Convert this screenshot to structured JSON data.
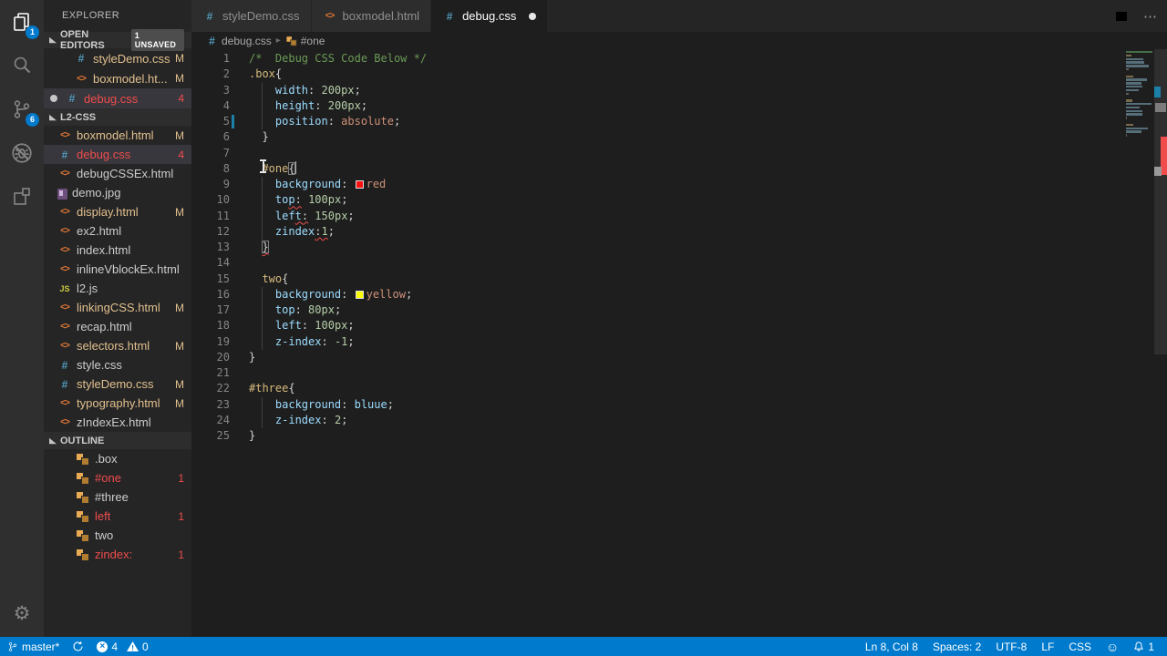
{
  "activity_bar": {
    "explorer_badge": "1",
    "scm_badge": "6"
  },
  "sidebar": {
    "title": "EXPLORER",
    "open_editors": {
      "label": "OPEN EDITORS",
      "badge": "1 UNSAVED",
      "items": [
        {
          "name": "styleDemo.css",
          "icon": "css",
          "git": "M",
          "modified": true
        },
        {
          "name": "boxmodel.ht...",
          "icon": "html",
          "git": "M",
          "modified": true
        },
        {
          "name": "debug.css",
          "icon": "css",
          "git": "4",
          "git_error": true,
          "error_name": true,
          "dirty": true,
          "selected": true
        }
      ]
    },
    "folder": {
      "label": "L2-CSS",
      "files": [
        {
          "name": "boxmodel.html",
          "icon": "html",
          "git": "M",
          "modified": true
        },
        {
          "name": "debug.css",
          "icon": "css",
          "git": "4",
          "git_error": true,
          "error_name": true,
          "selected": true
        },
        {
          "name": "debugCSSEx.html",
          "icon": "html"
        },
        {
          "name": "demo.jpg",
          "icon": "img"
        },
        {
          "name": "display.html",
          "icon": "html",
          "git": "M",
          "modified": true
        },
        {
          "name": "ex2.html",
          "icon": "html"
        },
        {
          "name": "index.html",
          "icon": "html"
        },
        {
          "name": "inlineVblockEx.html",
          "icon": "html"
        },
        {
          "name": "l2.js",
          "icon": "js"
        },
        {
          "name": "linkingCSS.html",
          "icon": "html",
          "git": "M",
          "modified": true
        },
        {
          "name": "recap.html",
          "icon": "html"
        },
        {
          "name": "selectors.html",
          "icon": "html",
          "git": "M",
          "modified": true
        },
        {
          "name": "style.css",
          "icon": "css"
        },
        {
          "name": "styleDemo.css",
          "icon": "css",
          "git": "M",
          "modified": true
        },
        {
          "name": "typography.html",
          "icon": "html",
          "git": "M",
          "modified": true
        },
        {
          "name": "zIndexEx.html",
          "icon": "html"
        }
      ]
    },
    "outline": {
      "label": "OUTLINE",
      "items": [
        {
          "name": ".box"
        },
        {
          "name": "#one",
          "badge": "1",
          "error_name": true
        },
        {
          "name": "#three"
        },
        {
          "name": "left",
          "badge": "1",
          "error_name": true
        },
        {
          "name": "two"
        },
        {
          "name": "zindex:",
          "badge": "1",
          "error_name": true
        }
      ]
    }
  },
  "tabs": [
    {
      "name": "styleDemo.css",
      "icon": "css",
      "active": false,
      "dirty": false
    },
    {
      "name": "boxmodel.html",
      "icon": "html",
      "active": false,
      "dirty": false
    },
    {
      "name": "debug.css",
      "icon": "css",
      "active": true,
      "dirty": true
    }
  ],
  "breadcrumb": [
    {
      "label": "debug.css",
      "icon": "css"
    },
    {
      "label": "#one",
      "icon": "symbol"
    }
  ],
  "code": {
    "lines": [
      {
        "n": 1,
        "s": [
          {
            "t": "/*  Debug CSS Code Below */",
            "c": "cm"
          }
        ]
      },
      {
        "n": 2,
        "s": [
          {
            "t": ".box",
            "c": "sel"
          },
          {
            "t": "{",
            "c": "pu"
          }
        ]
      },
      {
        "n": 3,
        "s": [
          {
            "t": "    "
          },
          {
            "t": "width",
            "c": "pr"
          },
          {
            "t": ": ",
            "c": "pu"
          },
          {
            "t": "200px",
            "c": "num"
          },
          {
            "t": ";",
            "c": "pu"
          }
        ]
      },
      {
        "n": 4,
        "s": [
          {
            "t": "    "
          },
          {
            "t": "height",
            "c": "pr"
          },
          {
            "t": ": ",
            "c": "pu"
          },
          {
            "t": "200px",
            "c": "num"
          },
          {
            "t": ";",
            "c": "pu"
          }
        ]
      },
      {
        "n": 5,
        "marker": true,
        "s": [
          {
            "t": "    "
          },
          {
            "t": "position",
            "c": "pr"
          },
          {
            "t": ": ",
            "c": "pu"
          },
          {
            "t": "absolute",
            "c": "val"
          },
          {
            "t": ";",
            "c": "pu"
          }
        ]
      },
      {
        "n": 6,
        "s": [
          {
            "t": "  "
          },
          {
            "t": "}",
            "c": "pu"
          }
        ]
      },
      {
        "n": 7,
        "s": []
      },
      {
        "n": 8,
        "s": [
          {
            "t": "  "
          },
          {
            "t": "#one",
            "c": "sel"
          },
          {
            "t": "{",
            "c": "pu",
            "b": true
          },
          {
            "cur": true
          }
        ]
      },
      {
        "n": 9,
        "s": [
          {
            "t": "    "
          },
          {
            "t": "background",
            "c": "pr"
          },
          {
            "t": ": ",
            "c": "pu"
          },
          {
            "sw": "#ff1111"
          },
          {
            "t": "red",
            "c": "val"
          }
        ]
      },
      {
        "n": 10,
        "s": [
          {
            "t": "    "
          },
          {
            "t": "to",
            "c": "pr"
          },
          {
            "t": "p",
            "c": "pr",
            "e": true
          },
          {
            "t": ":",
            "c": "pu",
            "e": true
          },
          {
            "t": " "
          },
          {
            "t": "100px",
            "c": "num"
          },
          {
            "t": ";",
            "c": "pu"
          }
        ]
      },
      {
        "n": 11,
        "s": [
          {
            "t": "    "
          },
          {
            "t": "lef",
            "c": "pr"
          },
          {
            "t": "t",
            "c": "pr",
            "e": true
          },
          {
            "t": ":",
            "c": "pu",
            "e": true
          },
          {
            "t": " "
          },
          {
            "t": "150px",
            "c": "num"
          },
          {
            "t": ";",
            "c": "pu"
          }
        ]
      },
      {
        "n": 12,
        "s": [
          {
            "t": "    "
          },
          {
            "t": "zindex",
            "c": "pr"
          },
          {
            "t": ":",
            "c": "pu",
            "e": true
          },
          {
            "t": "1",
            "c": "num",
            "e": true
          },
          {
            "t": ";",
            "c": "pu"
          }
        ]
      },
      {
        "n": 13,
        "s": [
          {
            "t": "  "
          },
          {
            "t": "}",
            "c": "pu",
            "b": true,
            "e": true
          }
        ]
      },
      {
        "n": 14,
        "s": []
      },
      {
        "n": 15,
        "s": [
          {
            "t": "  "
          },
          {
            "t": "two",
            "c": "sel"
          },
          {
            "t": "{",
            "c": "pu"
          }
        ]
      },
      {
        "n": 16,
        "s": [
          {
            "t": "    "
          },
          {
            "t": "background",
            "c": "pr"
          },
          {
            "t": ": ",
            "c": "pu"
          },
          {
            "sw": "#ffff00"
          },
          {
            "t": "yellow",
            "c": "val"
          },
          {
            "t": ";",
            "c": "pu"
          }
        ]
      },
      {
        "n": 17,
        "s": [
          {
            "t": "    "
          },
          {
            "t": "top",
            "c": "pr"
          },
          {
            "t": ": ",
            "c": "pu"
          },
          {
            "t": "80px",
            "c": "num"
          },
          {
            "t": ";",
            "c": "pu"
          }
        ]
      },
      {
        "n": 18,
        "s": [
          {
            "t": "    "
          },
          {
            "t": "left",
            "c": "pr"
          },
          {
            "t": ": ",
            "c": "pu"
          },
          {
            "t": "100px",
            "c": "num"
          },
          {
            "t": ";",
            "c": "pu"
          }
        ]
      },
      {
        "n": 19,
        "s": [
          {
            "t": "    "
          },
          {
            "t": "z-index",
            "c": "pr"
          },
          {
            "t": ": ",
            "c": "pu"
          },
          {
            "t": "-1",
            "c": "num"
          },
          {
            "t": ";",
            "c": "pu"
          }
        ]
      },
      {
        "n": 20,
        "s": [
          {
            "t": "}",
            "c": "pu"
          }
        ]
      },
      {
        "n": 21,
        "s": []
      },
      {
        "n": 22,
        "s": [
          {
            "t": "#three",
            "c": "sel"
          },
          {
            "t": "{",
            "c": "pu"
          }
        ]
      },
      {
        "n": 23,
        "s": [
          {
            "t": "    "
          },
          {
            "t": "background",
            "c": "pr"
          },
          {
            "t": ": ",
            "c": "pu"
          },
          {
            "t": "bluue",
            "c": "blu"
          },
          {
            "t": ";",
            "c": "pu"
          }
        ]
      },
      {
        "n": 24,
        "s": [
          {
            "t": "    "
          },
          {
            "t": "z-index",
            "c": "pr"
          },
          {
            "t": ": ",
            "c": "pu"
          },
          {
            "t": "2",
            "c": "num"
          },
          {
            "t": ";",
            "c": "pu"
          }
        ]
      },
      {
        "n": 25,
        "s": [
          {
            "t": "}",
            "c": "pu"
          }
        ]
      }
    ]
  },
  "status_bar": {
    "branch": "master*",
    "errors": "4",
    "warnings": "0",
    "right_items": [
      "Ln 8, Col 8",
      "Spaces: 2",
      "UTF-8",
      "LF",
      "CSS"
    ],
    "bell_count": "1",
    "accent": "#007acc"
  }
}
